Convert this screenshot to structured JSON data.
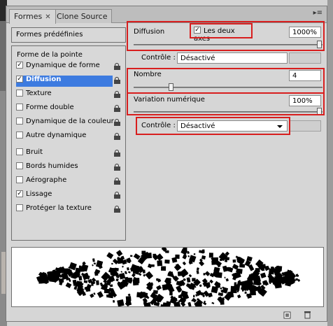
{
  "tabs": [
    {
      "label": "Formes",
      "active": true
    },
    {
      "label": "Clone Source",
      "active": false
    }
  ],
  "left": {
    "preset_label": "Formes prédéfinies",
    "header": "Forme de la pointe",
    "items": [
      {
        "label": "Dynamique de forme",
        "checked": true,
        "selected": false,
        "lock": true
      },
      {
        "label": "Diffusion",
        "checked": true,
        "selected": true,
        "lock": true
      },
      {
        "label": "Texture",
        "checked": false,
        "selected": false,
        "lock": true
      },
      {
        "label": "Forme double",
        "checked": false,
        "selected": false,
        "lock": true
      },
      {
        "label": "Dynamique de la couleur",
        "checked": false,
        "selected": false,
        "lock": true
      },
      {
        "label": "Autre dynamique",
        "checked": false,
        "selected": false,
        "lock": true
      },
      {
        "label": "Bruit",
        "checked": false,
        "selected": false,
        "lock": true
      },
      {
        "label": "Bords humides",
        "checked": false,
        "selected": false,
        "lock": true
      },
      {
        "label": "Aérographe",
        "checked": false,
        "selected": false,
        "lock": true
      },
      {
        "label": "Lissage",
        "checked": true,
        "selected": false,
        "lock": true
      },
      {
        "label": "Protéger la texture",
        "checked": false,
        "selected": false,
        "lock": true
      }
    ]
  },
  "scatter": {
    "label": "Diffusion",
    "both_axes_label": "Les deux axes",
    "both_axes_checked": true,
    "value": "1000%",
    "level": 1.0
  },
  "control1": {
    "label": "Contrôle :",
    "value": "Désactivé"
  },
  "count": {
    "label": "Nombre",
    "value": "4",
    "level": 0.19
  },
  "count_jitter": {
    "label": "Variation numérique",
    "value": "100%",
    "level": 1.0
  },
  "control2": {
    "label": "Contrôle :",
    "value": "Désactivé"
  },
  "colors": {
    "selection": "#3d7be0",
    "highlight": "#d81e1e"
  }
}
